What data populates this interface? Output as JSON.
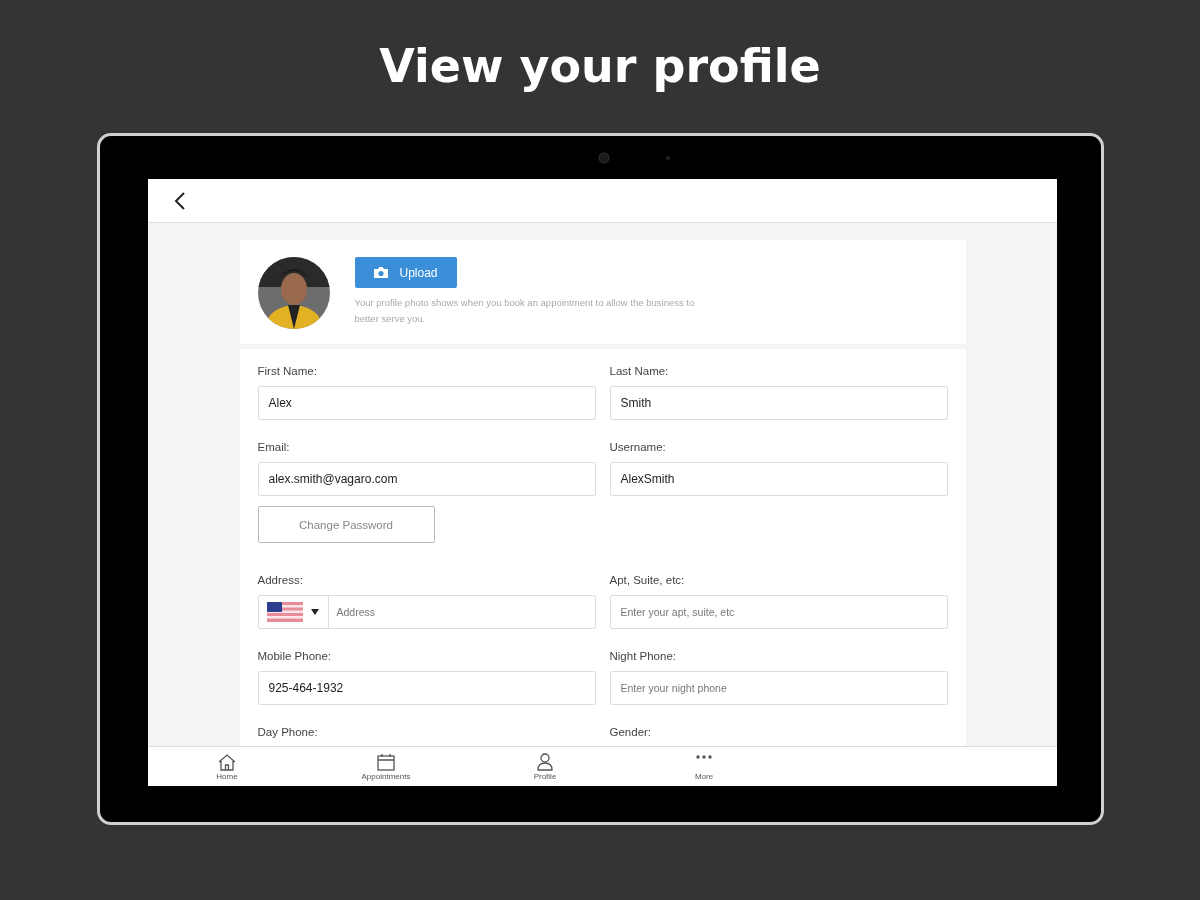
{
  "headline": "View your profile",
  "profile_photo": {
    "kind": "picture",
    "upload_button": "Upload",
    "description": "Your profile photo shows when you book an appointment to allow the business to better serve you."
  },
  "fields_top": [
    {
      "label": "First Name:",
      "value": "Alex"
    },
    {
      "label": "Last Name:",
      "value": "Smith"
    },
    {
      "label": "Email:",
      "value": "alex.smith@vagaro.com"
    },
    {
      "label": "Username:",
      "value": "AlexSmith"
    }
  ],
  "change_password_button": "Change Password",
  "fields_bottom": [
    {
      "label": "Address:",
      "placeholder": "Address",
      "kind": "address"
    },
    {
      "label": "Apt, Suite, etc:",
      "placeholder": "Enter your apt, suite, etc",
      "kind": "text"
    },
    {
      "label": "Mobile Phone:",
      "value": "925-464-1932",
      "kind": "text"
    },
    {
      "label": "Night Phone:",
      "placeholder": "Enter your night phone",
      "kind": "text"
    },
    {
      "label": "Day Phone:",
      "kind": "label"
    },
    {
      "label": "Gender:",
      "kind": "label"
    }
  ],
  "tab_bar": [
    {
      "label": "Home",
      "kind": "home",
      "selected": false
    },
    {
      "label": "Appointments",
      "kind": "calendar",
      "selected": false
    },
    {
      "label": "Profile",
      "kind": "person",
      "selected": false
    },
    {
      "label": "More",
      "kind": "more",
      "selected": false
    }
  ]
}
